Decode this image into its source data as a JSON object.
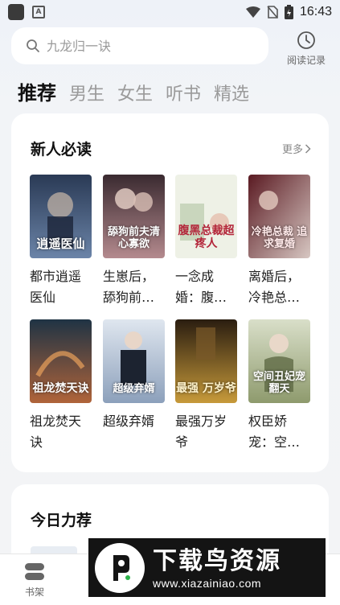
{
  "status_bar": {
    "time": "16:43"
  },
  "search": {
    "placeholder": "九龙归一诀"
  },
  "history": {
    "label": "阅读记录"
  },
  "tabs": [
    {
      "label": "推荐",
      "active": true
    },
    {
      "label": "男生",
      "active": false
    },
    {
      "label": "女生",
      "active": false
    },
    {
      "label": "听书",
      "active": false
    },
    {
      "label": "精选",
      "active": false
    }
  ],
  "new_reader": {
    "title": "新人必读",
    "more_label": "更多",
    "books": [
      {
        "name": "都市逍遥医仙",
        "cover_text": "逍遥医仙",
        "colors": [
          "#2a3a55",
          "#6b84a8"
        ]
      },
      {
        "name": "生崽后，舔狗前夫清心寡欲",
        "cover_text": "舔狗前夫清心寡欲",
        "colors": [
          "#3a2a30",
          "#b48a8e"
        ]
      },
      {
        "name": "一念成婚：腹黑总裁超疼人",
        "cover_text": "腹黑总裁超疼人",
        "colors": [
          "#dfe7d6",
          "#f3f1e6"
        ]
      },
      {
        "name": "离婚后，冷艳总裁求复婚",
        "cover_text": "冷艳总裁 追求复婚",
        "colors": [
          "#5a1a22",
          "#d7c7c2"
        ]
      },
      {
        "name": "祖龙焚天诀",
        "cover_text": "祖龙焚天诀",
        "colors": [
          "#1f3344",
          "#b0643a"
        ]
      },
      {
        "name": "超级弃婿",
        "cover_text": "超级弃婿",
        "colors": [
          "#dfe6ef",
          "#8ca0bb"
        ]
      },
      {
        "name": "最强万岁爷",
        "cover_text": "最强 万岁爷",
        "colors": [
          "#2a1d10",
          "#c79a3a"
        ]
      },
      {
        "name": "权臣娇宠：空间丑妃宠翻天",
        "cover_text": "空间丑妃宠翻天",
        "colors": [
          "#d9dfc9",
          "#8e9a6d"
        ]
      }
    ]
  },
  "today": {
    "title": "今日力荐"
  },
  "bottom_nav": {
    "shelf_label": "书架"
  },
  "watermark": {
    "name": "下载鸟资源",
    "url": "www.xiazainiao.com"
  }
}
